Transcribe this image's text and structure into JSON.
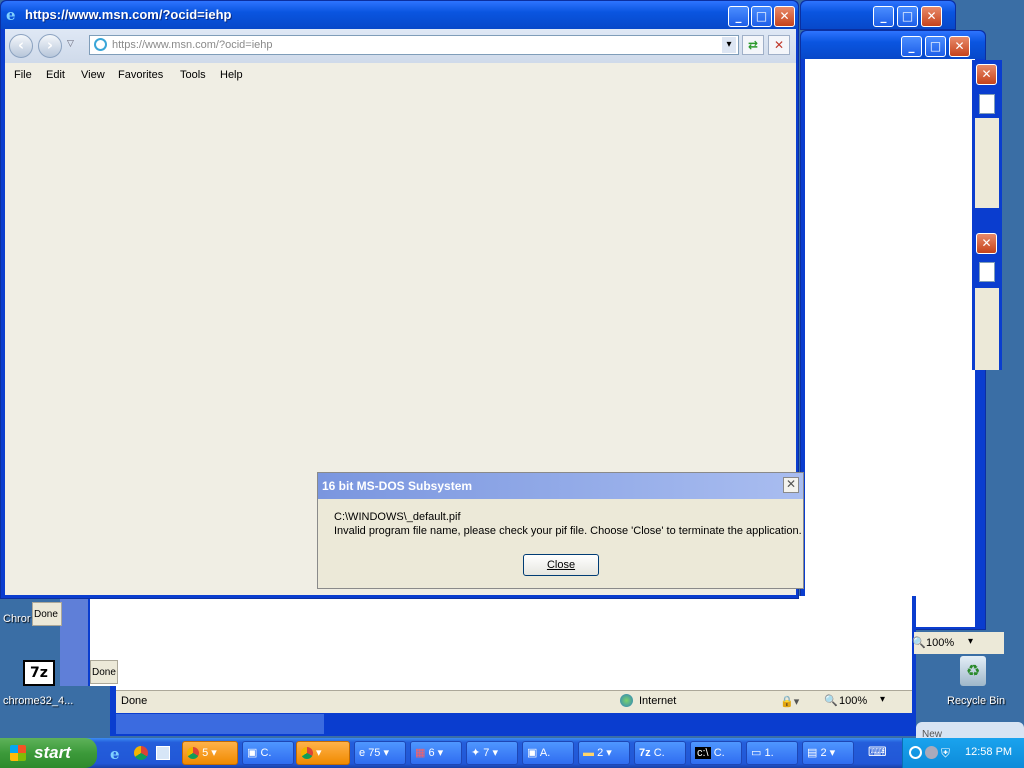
{
  "main_window": {
    "title": "https://www.msn.com/?ocid=iehp",
    "address": "https://www.msn.com/?ocid=iehp",
    "menu": [
      "File",
      "Edit",
      "View",
      "Favorites",
      "Tools",
      "Help"
    ]
  },
  "background_windows": {
    "status_done": "Done",
    "status_internet": "Internet",
    "zoom_a": "100%",
    "zoom_b": "100%"
  },
  "dialog": {
    "title": "16 bit MS-DOS Subsystem",
    "path": "C:\\WINDOWS\\_default.pif",
    "message": "Invalid program file name, please check your pif file. Choose 'Close' to terminate the application.",
    "close_label": "Close"
  },
  "desktop": {
    "icon_7z_label": "chrome32_4...",
    "chrome_label": "Chror",
    "recycle_bin_label": "Recycle Bin",
    "done_a": "Done",
    "done_b": "Done",
    "new_label": "New"
  },
  "taskbar": {
    "start_label": "start",
    "items": [
      {
        "label": "5",
        "group": "chrome"
      },
      {
        "label": "C.",
        "group": "app"
      },
      {
        "label": "",
        "group": "chrome"
      },
      {
        "label": "75",
        "group": "ie"
      },
      {
        "label": "6",
        "group": "dev"
      },
      {
        "label": "7",
        "group": "app"
      },
      {
        "label": "A.",
        "group": "app"
      },
      {
        "label": "2",
        "group": "folder"
      },
      {
        "label": "C.",
        "group": "7z"
      },
      {
        "label": "C.",
        "group": "cmd"
      },
      {
        "label": "1.",
        "group": "window"
      },
      {
        "label": "2",
        "group": "doc"
      }
    ],
    "clock": "12:58 PM",
    "accent_color": "#245edb"
  }
}
